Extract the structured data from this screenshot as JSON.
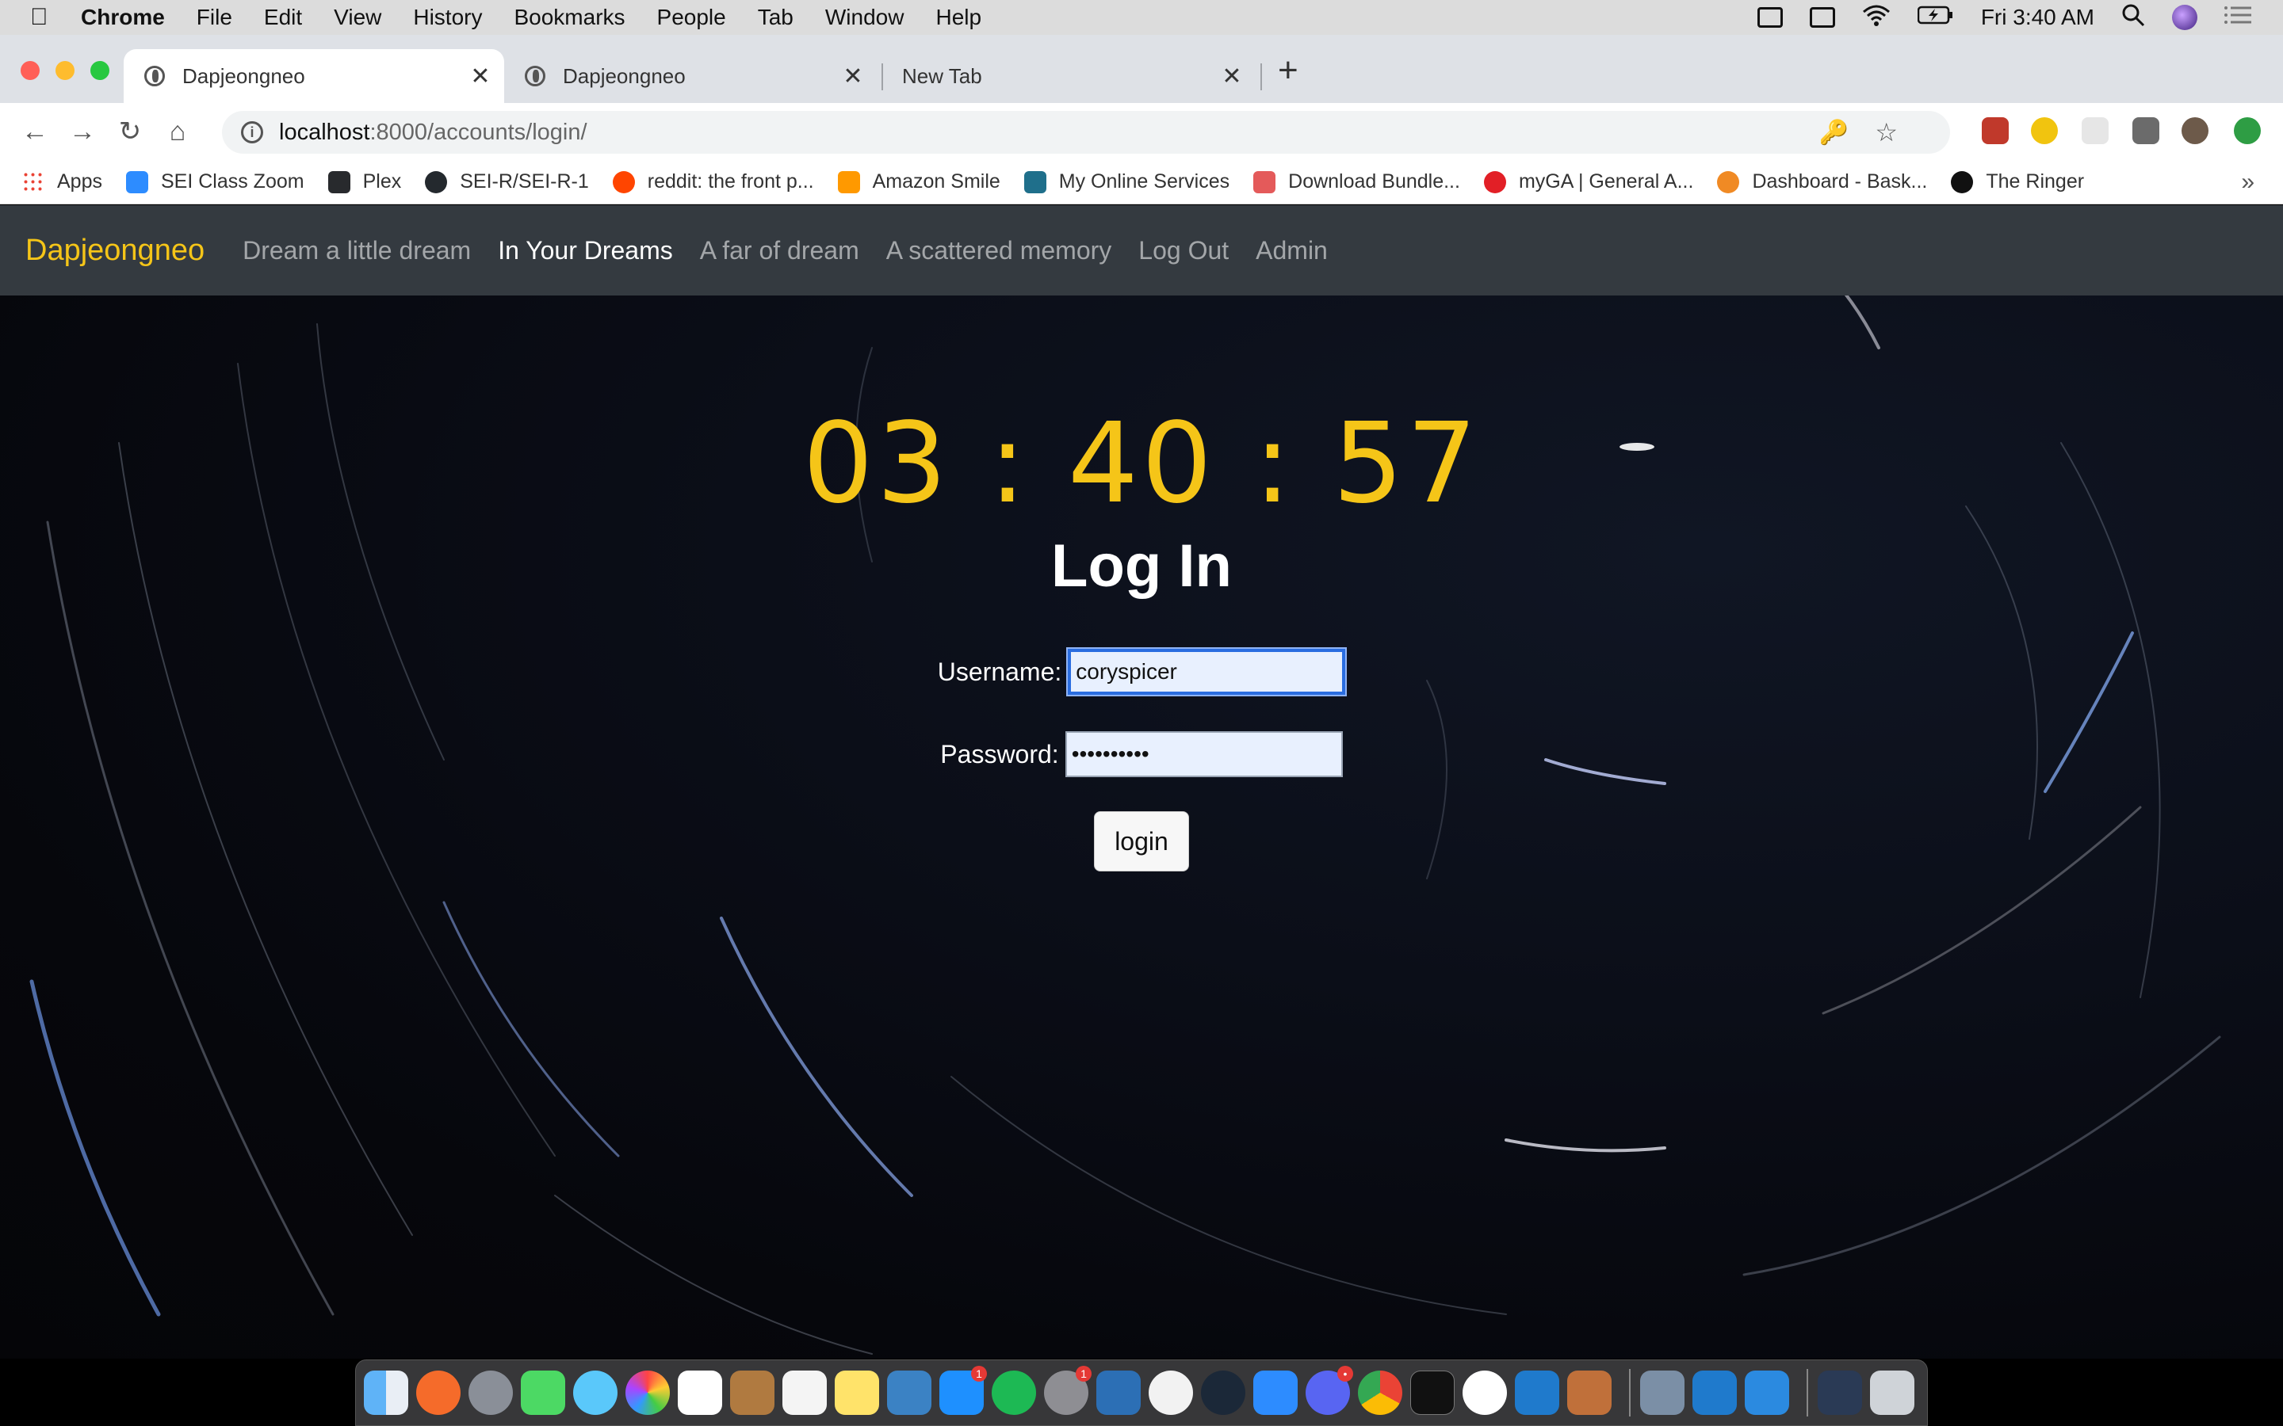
{
  "menubar": {
    "app": "Chrome",
    "items": [
      "File",
      "Edit",
      "View",
      "History",
      "Bookmarks",
      "People",
      "Tab",
      "Window",
      "Help"
    ],
    "clock": "Fri 3:40 AM"
  },
  "tabs": [
    {
      "title": "Dapjeongneo"
    },
    {
      "title": "Dapjeongneo"
    },
    {
      "title": "New Tab"
    }
  ],
  "omnibox": {
    "host": "localhost",
    "path": ":8000/accounts/login/"
  },
  "bookmarks": [
    {
      "label": "Apps",
      "color": "#4285f4"
    },
    {
      "label": "SEI Class Zoom",
      "color": "#2d8cff"
    },
    {
      "label": "Plex",
      "color": "#282a2d"
    },
    {
      "label": "SEI-R/SEI-R-1",
      "color": "#24292e"
    },
    {
      "label": "reddit: the front p...",
      "color": "#ff4500"
    },
    {
      "label": "Amazon Smile",
      "color": "#ff9900"
    },
    {
      "label": "My Online Services",
      "color": "#1f6f8b"
    },
    {
      "label": "Download Bundle...",
      "color": "#e45a5a"
    },
    {
      "label": "myGA | General A...",
      "color": "#e21f26"
    },
    {
      "label": "Dashboard - Bask...",
      "color": "#f08a24"
    },
    {
      "label": "The Ringer",
      "color": "#111111"
    }
  ],
  "navbar": {
    "brand": "Dapjeongneo",
    "links": [
      "Dream a little dream",
      "In Your Dreams",
      "A far of dream",
      "A scattered memory",
      "Log Out",
      "Admin"
    ]
  },
  "clock_display": "03 : 40 : 57",
  "login": {
    "heading": "Log In",
    "username_label": "Username:",
    "username_value": "coryspicer",
    "password_label": "Password:",
    "password_value": "••••••••••",
    "button_label": "login"
  },
  "colors": {
    "brand": "#f5c518",
    "navbar": "#343a40",
    "input_bg": "#e8f0fe",
    "focus": "#2a6de0"
  }
}
